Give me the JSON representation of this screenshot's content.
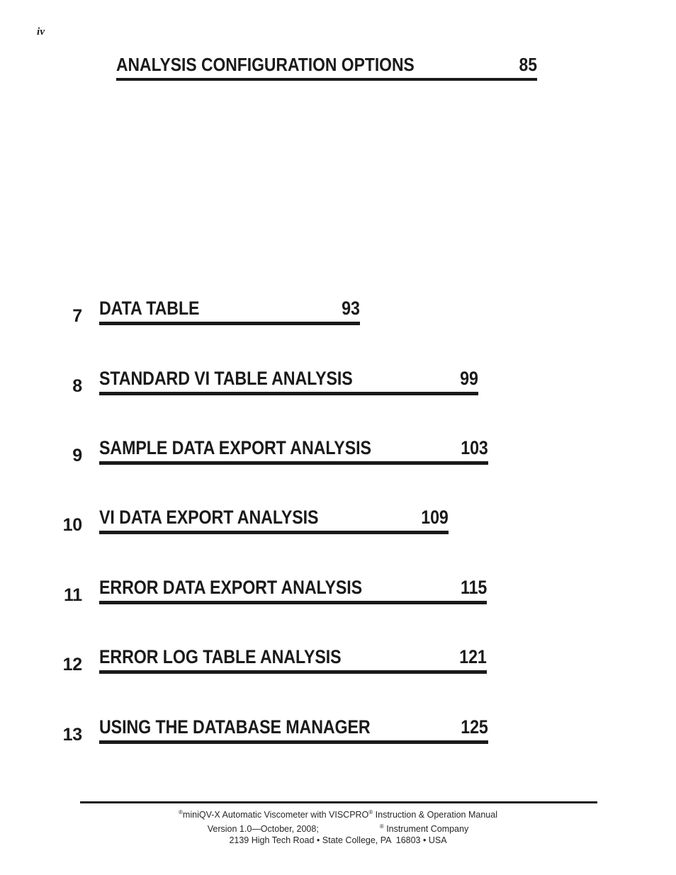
{
  "page": {
    "folio": "iv"
  },
  "header": {
    "title": "ANALYSIS CONFIGURATION OPTIONS",
    "page": "85"
  },
  "toc": {
    "entries": [
      {
        "number": "7",
        "title": "DATA TABLE",
        "page": "93"
      },
      {
        "number": "8",
        "title": "STANDARD VI TABLE ANALYSIS",
        "page": "99"
      },
      {
        "number": "9",
        "title": "SAMPLE DATA EXPORT ANALYSIS",
        "page": "103"
      },
      {
        "number": "10",
        "title": "VI DATA EXPORT ANALYSIS",
        "page": "109"
      },
      {
        "number": "11",
        "title": "ERROR DATA EXPORT ANALYSIS",
        "page": "115"
      },
      {
        "number": "12",
        "title": "ERROR LOG TABLE ANALYSIS",
        "page": "121"
      },
      {
        "number": "13",
        "title": "USING THE DATABASE MANAGER",
        "page": "125"
      }
    ]
  },
  "footer": {
    "line1_pre": "miniQV-X Automatic Viscometer with VISCPRO",
    "line1_post": " Instruction & Operation Manual",
    "line2_pre": "Version 1.0—October, 2008;",
    "line2_post": " Instrument Company",
    "line3": "2139 High Tech Road • State College, PA  16803 • USA",
    "registered_mark": "®"
  }
}
